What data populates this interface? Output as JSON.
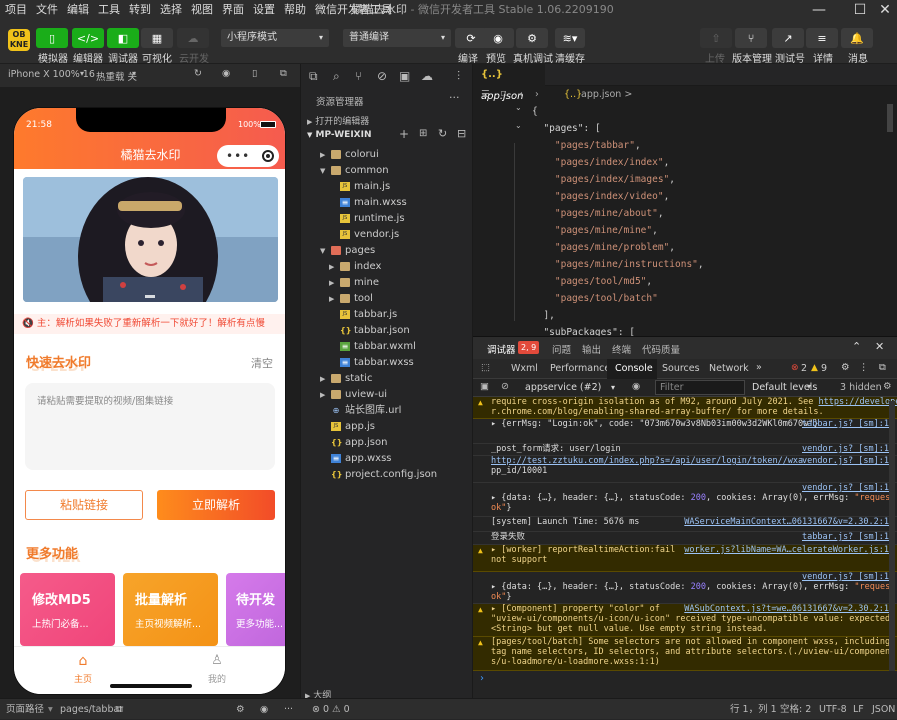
{
  "menubar": {
    "items": [
      "项目",
      "文件",
      "编辑",
      "工具",
      "转到",
      "选择",
      "视图",
      "界面",
      "设置",
      "帮助",
      "微信开发者工具"
    ]
  },
  "window": {
    "title": "橘猫去水印",
    "subtitle": " - 微信开发者工具 Stable 1.06.2209190"
  },
  "toolbar": {
    "buttons": [
      "模拟器",
      "编辑器",
      "调试器",
      "可视化",
      "云开发"
    ],
    "mode_select": "小程序模式",
    "compile_select": "普通编译",
    "right_actions": [
      "编译",
      "预览",
      "真机调试",
      "清缓存"
    ],
    "far_actions": [
      "上传",
      "版本管理",
      "测试号",
      "详情",
      "消息"
    ]
  },
  "simulator": {
    "device": "iPhone X 100% 16",
    "hotreload": "热重载 关",
    "status_time": "21:58",
    "battery": "100%",
    "page_title": "橘猫去水印",
    "notice_text": "🔇 主：解析如果失败了重新解析一下就好了！解析有点慢",
    "quick_title": "快速去水印",
    "quick_shadow": "SPEEDY",
    "clear_label": "清空",
    "textarea_placeholder": "请粘贴需要提取的视频/图集链接",
    "paste_button": "粘贴链接",
    "parse_button": "立即解析",
    "more_title": "更多功能",
    "more_shadow": "OTHER",
    "cards": [
      {
        "title": "修改MD5",
        "sub": "上热门必备...",
        "color": "#f2457b"
      },
      {
        "title": "批量解析",
        "sub": "主页视频解析...",
        "color": "#f59a1a"
      },
      {
        "title": "待开发",
        "sub": "更多功能...",
        "color": "#c86de3"
      }
    ],
    "tabs": [
      {
        "label": "主页"
      },
      {
        "label": "我的"
      }
    ]
  },
  "explorer": {
    "title": "资源管理器",
    "open_editors": "打开的编辑器",
    "project": "MP-WEIXIN",
    "outline": "大纲",
    "tree": [
      {
        "label": "colorui",
        "kind": "folder",
        "depth": 1,
        "open": false
      },
      {
        "label": "common",
        "kind": "folder",
        "depth": 1,
        "open": true
      },
      {
        "label": "main.js",
        "kind": "js",
        "depth": 2
      },
      {
        "label": "main.wxss",
        "kind": "wxss",
        "depth": 2
      },
      {
        "label": "runtime.js",
        "kind": "js",
        "depth": 2
      },
      {
        "label": "vendor.js",
        "kind": "js",
        "depth": 2
      },
      {
        "label": "pages",
        "kind": "folder-red",
        "depth": 1,
        "open": true
      },
      {
        "label": "index",
        "kind": "folder",
        "depth": 2,
        "open": false
      },
      {
        "label": "mine",
        "kind": "folder",
        "depth": 2,
        "open": false
      },
      {
        "label": "tool",
        "kind": "folder",
        "depth": 2,
        "open": false
      },
      {
        "label": "tabbar.js",
        "kind": "js",
        "depth": 2
      },
      {
        "label": "tabbar.json",
        "kind": "json",
        "depth": 2
      },
      {
        "label": "tabbar.wxml",
        "kind": "wxml",
        "depth": 2
      },
      {
        "label": "tabbar.wxss",
        "kind": "wxss",
        "depth": 2
      },
      {
        "label": "static",
        "kind": "folder",
        "depth": 1,
        "open": false
      },
      {
        "label": "uview-ui",
        "kind": "folder",
        "depth": 1,
        "open": false
      },
      {
        "label": "站长图库.url",
        "kind": "url",
        "depth": 1
      },
      {
        "label": "app.js",
        "kind": "js",
        "depth": 1
      },
      {
        "label": "app.json",
        "kind": "json",
        "depth": 1
      },
      {
        "label": "app.wxss",
        "kind": "wxss",
        "depth": 1
      },
      {
        "label": "project.config.json",
        "kind": "json",
        "depth": 1
      }
    ]
  },
  "editor": {
    "tab": "app.json",
    "breadcrumb": "app.json >",
    "lines": [
      {
        "t": "{"
      },
      {
        "t": "  \"pages\": ["
      },
      {
        "t": "    \"pages/tabbar\","
      },
      {
        "t": "    \"pages/index/index\","
      },
      {
        "t": "    \"pages/index/images\","
      },
      {
        "t": "    \"pages/index/video\","
      },
      {
        "t": "    \"pages/mine/about\","
      },
      {
        "t": "    \"pages/mine/mine\","
      },
      {
        "t": "    \"pages/mine/problem\","
      },
      {
        "t": "    \"pages/mine/instructions\","
      },
      {
        "t": "    \"pages/tool/md5\","
      },
      {
        "t": "    \"pages/tool/batch\""
      },
      {
        "t": "  ],"
      },
      {
        "t": "  \"subPackages\": ["
      }
    ]
  },
  "devtools": {
    "top_tabs": [
      "调试器",
      "问题",
      "输出",
      "终端",
      "代码质量"
    ],
    "error_badge": "2, 9",
    "tabs": [
      "Wxml",
      "Performance",
      "Console",
      "Sources",
      "Network"
    ],
    "active_tab": "Console",
    "err_count": "2",
    "warn_count": "9",
    "context": "appservice (#2)",
    "filter_placeholder": "Filter",
    "levels": "Default levels",
    "hidden": "3 hidden",
    "logs": [
      {
        "text": "require cross-origin isolation as of M92, around July 2021. See https://develope\nr.chrome.com/blog/enabling-shared-array-buffer/ for more details.",
        "src": "",
        "lvl": "warn"
      },
      {
        "text": "▸ {errMsg: \"Login:ok\", code: \"073m670w3v8Nb03im00w3d2WKl0m670w\"}",
        "src": "tabbar.js? [sm]:1",
        "lvl": "info"
      },
      {
        "text": "_post_form请求: user/login",
        "src": "vendor.js? [sm]:1",
        "lvl": "info"
      },
      {
        "text": "http://test.zztuku.com/index.php?s=/api/user/login/token//wxa\npp_id/10001",
        "src": "vendor.js? [sm]:1",
        "lvl": "info"
      },
      {
        "text": "▸ {data: {…}, header: {…}, statusCode: 200, cookies: Array(0), errMsg: \"request:\nok\"}",
        "src": "vendor.js? [sm]:1",
        "lvl": "info"
      },
      {
        "text": "[system] Launch Time: 5676 ms",
        "src": "WAServiceMainContext…06131667&v=2.30.2:1",
        "lvl": "info"
      },
      {
        "text": "登录失败",
        "src": "tabbar.js? [sm]:1",
        "lvl": "info"
      },
      {
        "text": "▸ [worker] reportRealtimeAction:fail\nnot support",
        "src": "worker.js?libName=WA…celerateWorker.js:1",
        "lvl": "warn"
      },
      {
        "text": "▸ {data: {…}, header: {…}, statusCode: 200, cookies: Array(0), errMsg: \"request:\nok\"}",
        "src": "vendor.js? [sm]:1",
        "lvl": "info"
      },
      {
        "text": "▸ [Component] property \"color\" of\n\"uview-ui/components/u-icon/u-icon\" received type-uncompatible value: expected\n<String> but get null value. Use empty string instead.",
        "src": "WASubContext.js?t=we…06131667&v=2.30.2:1",
        "lvl": "warn"
      },
      {
        "text": "[pages/tool/batch] Some selectors are not allowed in component wxss, including\ntag name selectors, ID selectors, and attribute selectors.(./uview-ui/component\ns/u-loadmore/u-loadmore.wxss:1:1)",
        "src": "",
        "lvl": "warn"
      }
    ]
  },
  "statusbar": {
    "page_path_label": "页面路径",
    "page_path": "pages/tabbar",
    "errors": "⊗ 0 ⚠ 0",
    "cursor": "行 1，列 1",
    "spaces": "空格: 2",
    "encoding": "UTF-8",
    "eol": "LF",
    "lang": "JSON"
  }
}
